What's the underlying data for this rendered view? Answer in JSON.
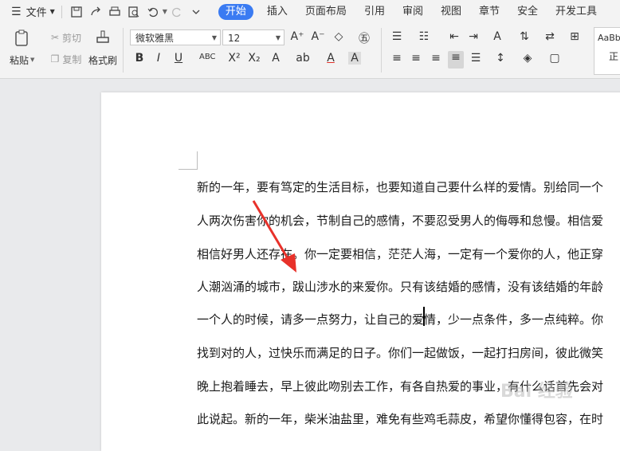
{
  "menubar": {
    "file_label": "文件",
    "tabs": [
      "开始",
      "插入",
      "页面布局",
      "引用",
      "审阅",
      "视图",
      "章节",
      "安全",
      "开发工具"
    ]
  },
  "ribbon": {
    "paste_label": "粘贴",
    "cut_label": "剪切",
    "copy_label": "复制",
    "format_painter_label": "格式刷",
    "font_name": "微软雅黑",
    "font_size": "12",
    "style_preview": "AaBb",
    "style_name": "正"
  },
  "document": {
    "lines": [
      "新的一年，要有笃定的生活目标，也要知道自己要什么样的爱情。别给同一个",
      "人两次伤害你的机会，节制自己的感情，不要忍受男人的侮辱和怠慢。相信爱",
      "相信好男人还存在。你一定要相信，茫茫人海，一定有一个爱你的人，他正穿",
      "人潮汹涌的城市，跋山涉水的来爱你。只有该结婚的感情，没有该结婚的年龄",
      "一个人的时候，请多一点努力，让自己的爱情，少一点条件，多一点纯粹。你",
      "找到对的人，过快乐而满足的日子。你们一起做饭，一起打扫房间，彼此微笑",
      "晚上抱着睡去，早上彼此吻别去工作，有各自热爱的事业，有什么话首先会对",
      "此说起。新的一年，柴米油盐里，难免有些鸡毛蒜皮，希望你懂得包容，在时"
    ]
  },
  "watermark": "Bai 经验",
  "colors": {
    "accent": "#3a7bf2",
    "arrow": "#e8312a"
  }
}
